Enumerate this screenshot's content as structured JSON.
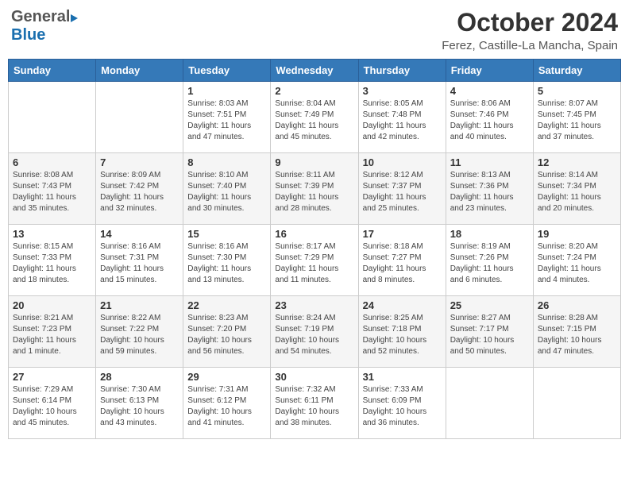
{
  "header": {
    "logo_general": "General",
    "logo_blue": "Blue",
    "month_title": "October 2024",
    "location": "Ferez, Castille-La Mancha, Spain"
  },
  "columns": [
    "Sunday",
    "Monday",
    "Tuesday",
    "Wednesday",
    "Thursday",
    "Friday",
    "Saturday"
  ],
  "weeks": [
    [
      {
        "day": "",
        "info": ""
      },
      {
        "day": "",
        "info": ""
      },
      {
        "day": "1",
        "info": "Sunrise: 8:03 AM\nSunset: 7:51 PM\nDaylight: 11 hours and 47 minutes."
      },
      {
        "day": "2",
        "info": "Sunrise: 8:04 AM\nSunset: 7:49 PM\nDaylight: 11 hours and 45 minutes."
      },
      {
        "day": "3",
        "info": "Sunrise: 8:05 AM\nSunset: 7:48 PM\nDaylight: 11 hours and 42 minutes."
      },
      {
        "day": "4",
        "info": "Sunrise: 8:06 AM\nSunset: 7:46 PM\nDaylight: 11 hours and 40 minutes."
      },
      {
        "day": "5",
        "info": "Sunrise: 8:07 AM\nSunset: 7:45 PM\nDaylight: 11 hours and 37 minutes."
      }
    ],
    [
      {
        "day": "6",
        "info": "Sunrise: 8:08 AM\nSunset: 7:43 PM\nDaylight: 11 hours and 35 minutes."
      },
      {
        "day": "7",
        "info": "Sunrise: 8:09 AM\nSunset: 7:42 PM\nDaylight: 11 hours and 32 minutes."
      },
      {
        "day": "8",
        "info": "Sunrise: 8:10 AM\nSunset: 7:40 PM\nDaylight: 11 hours and 30 minutes."
      },
      {
        "day": "9",
        "info": "Sunrise: 8:11 AM\nSunset: 7:39 PM\nDaylight: 11 hours and 28 minutes."
      },
      {
        "day": "10",
        "info": "Sunrise: 8:12 AM\nSunset: 7:37 PM\nDaylight: 11 hours and 25 minutes."
      },
      {
        "day": "11",
        "info": "Sunrise: 8:13 AM\nSunset: 7:36 PM\nDaylight: 11 hours and 23 minutes."
      },
      {
        "day": "12",
        "info": "Sunrise: 8:14 AM\nSunset: 7:34 PM\nDaylight: 11 hours and 20 minutes."
      }
    ],
    [
      {
        "day": "13",
        "info": "Sunrise: 8:15 AM\nSunset: 7:33 PM\nDaylight: 11 hours and 18 minutes."
      },
      {
        "day": "14",
        "info": "Sunrise: 8:16 AM\nSunset: 7:31 PM\nDaylight: 11 hours and 15 minutes."
      },
      {
        "day": "15",
        "info": "Sunrise: 8:16 AM\nSunset: 7:30 PM\nDaylight: 11 hours and 13 minutes."
      },
      {
        "day": "16",
        "info": "Sunrise: 8:17 AM\nSunset: 7:29 PM\nDaylight: 11 hours and 11 minutes."
      },
      {
        "day": "17",
        "info": "Sunrise: 8:18 AM\nSunset: 7:27 PM\nDaylight: 11 hours and 8 minutes."
      },
      {
        "day": "18",
        "info": "Sunrise: 8:19 AM\nSunset: 7:26 PM\nDaylight: 11 hours and 6 minutes."
      },
      {
        "day": "19",
        "info": "Sunrise: 8:20 AM\nSunset: 7:24 PM\nDaylight: 11 hours and 4 minutes."
      }
    ],
    [
      {
        "day": "20",
        "info": "Sunrise: 8:21 AM\nSunset: 7:23 PM\nDaylight: 11 hours and 1 minute."
      },
      {
        "day": "21",
        "info": "Sunrise: 8:22 AM\nSunset: 7:22 PM\nDaylight: 10 hours and 59 minutes."
      },
      {
        "day": "22",
        "info": "Sunrise: 8:23 AM\nSunset: 7:20 PM\nDaylight: 10 hours and 56 minutes."
      },
      {
        "day": "23",
        "info": "Sunrise: 8:24 AM\nSunset: 7:19 PM\nDaylight: 10 hours and 54 minutes."
      },
      {
        "day": "24",
        "info": "Sunrise: 8:25 AM\nSunset: 7:18 PM\nDaylight: 10 hours and 52 minutes."
      },
      {
        "day": "25",
        "info": "Sunrise: 8:27 AM\nSunset: 7:17 PM\nDaylight: 10 hours and 50 minutes."
      },
      {
        "day": "26",
        "info": "Sunrise: 8:28 AM\nSunset: 7:15 PM\nDaylight: 10 hours and 47 minutes."
      }
    ],
    [
      {
        "day": "27",
        "info": "Sunrise: 7:29 AM\nSunset: 6:14 PM\nDaylight: 10 hours and 45 minutes."
      },
      {
        "day": "28",
        "info": "Sunrise: 7:30 AM\nSunset: 6:13 PM\nDaylight: 10 hours and 43 minutes."
      },
      {
        "day": "29",
        "info": "Sunrise: 7:31 AM\nSunset: 6:12 PM\nDaylight: 10 hours and 41 minutes."
      },
      {
        "day": "30",
        "info": "Sunrise: 7:32 AM\nSunset: 6:11 PM\nDaylight: 10 hours and 38 minutes."
      },
      {
        "day": "31",
        "info": "Sunrise: 7:33 AM\nSunset: 6:09 PM\nDaylight: 10 hours and 36 minutes."
      },
      {
        "day": "",
        "info": ""
      },
      {
        "day": "",
        "info": ""
      }
    ]
  ]
}
